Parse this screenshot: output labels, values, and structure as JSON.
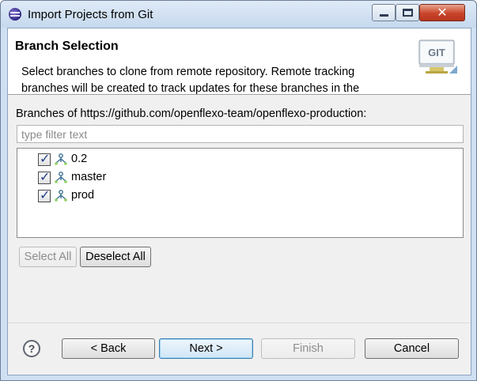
{
  "window": {
    "title": "Import Projects from Git",
    "app_icon": "eclipse-icon",
    "controls": [
      "minimize-icon",
      "maximize-icon",
      "close-icon"
    ]
  },
  "header": {
    "title": "Branch Selection",
    "description": "Select branches to clone from remote repository. Remote tracking branches will be created to track updates for these branches in the",
    "logo_text": "GIT"
  },
  "branches": {
    "label": "Branches of https://github.com/openflexo-team/openflexo-production:",
    "filter_placeholder": "type filter text",
    "items": [
      {
        "name": "0.2",
        "checked": true,
        "icon": "branch-icon"
      },
      {
        "name": "master",
        "checked": true,
        "icon": "branch-icon"
      },
      {
        "name": "prod",
        "checked": true,
        "icon": "branch-icon"
      }
    ],
    "select_all": "Select All",
    "deselect_all": "Deselect All"
  },
  "footer": {
    "help_icon": "help-icon",
    "back": "< Back",
    "next": "Next >",
    "finish": "Finish",
    "cancel": "Cancel"
  },
  "colors": {
    "frame": "#cfe0f3",
    "close_button": "#c9442a",
    "default_button": "#3c7fb1",
    "checkmark": "#1e3e86"
  }
}
